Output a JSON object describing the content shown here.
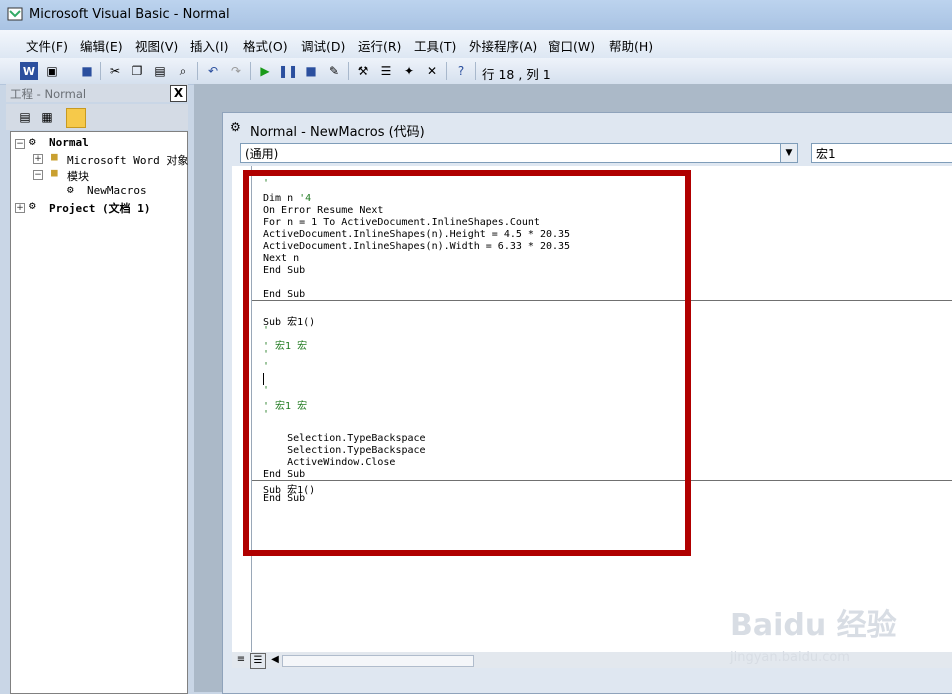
{
  "window": {
    "title": "Microsoft Visual Basic - Normal"
  },
  "menu": [
    "文件(F)",
    "编辑(E)",
    "视图(V)",
    "插入(I)",
    "格式(O)",
    "调试(D)",
    "运行(R)",
    "工具(T)",
    "外接程序(A)",
    "窗口(W)",
    "帮助(H)"
  ],
  "toolbar": {
    "status": "行 18 , 列 1"
  },
  "project": {
    "title": "工程 - Normal",
    "close": "X",
    "tree": {
      "normal": "Normal",
      "word_objects": "Microsoft Word 对象",
      "modules": "模块",
      "newmacros": "NewMacros",
      "project_doc": "Project (文档 1)"
    }
  },
  "codewindow": {
    "title": "Normal - NewMacros (代码)",
    "combo_left": "(通用)",
    "combo_right": "宏1"
  },
  "code": {
    "l1": "'",
    "l2a": "Dim n ",
    "l2b": "'4",
    "l3": "On Error Resume Next",
    "l4": "For n = 1 To ActiveDocument.InlineShapes.Count",
    "l5": "ActiveDocument.InlineShapes(n).Height = 4.5 * 20.35",
    "l6": "ActiveDocument.InlineShapes(n).Width = 6.33 * 20.35",
    "l7": "Next n",
    "l8": "End Sub",
    "l9": "End Sub",
    "l10": "Sub 宏1()",
    "l11": "'",
    "l12": "' 宏1 宏",
    "l13": "'",
    "l14": "'",
    "l15": "'",
    "l16": "' 宏1 宏",
    "l17": "'",
    "l18": "    Selection.TypeBackspace",
    "l19": "    Selection.TypeBackspace",
    "l20": "    ActiveWindow.Close",
    "l21": "End Sub",
    "l22": "Sub 宏1()",
    "l23": "End Sub"
  },
  "watermark": {
    "main": "Baidu 经验",
    "sub": "jingyan.baidu.com"
  },
  "colors": {
    "highlight": "#b00000",
    "comment": "#207a20"
  }
}
